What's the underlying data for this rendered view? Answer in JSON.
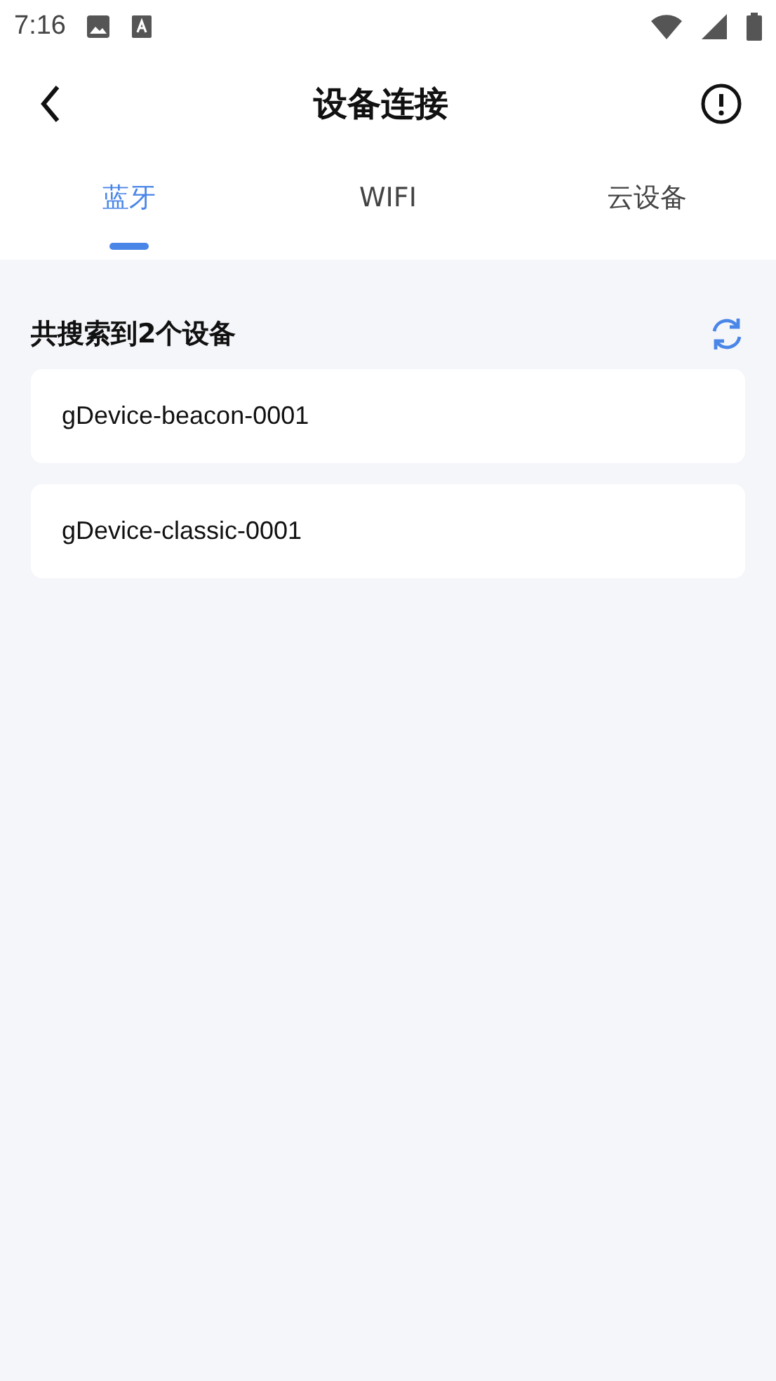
{
  "status_bar": {
    "time": "7:16"
  },
  "header": {
    "title": "设备连接"
  },
  "tabs": [
    {
      "label": "蓝牙",
      "selected": true
    },
    {
      "label": "WIFI",
      "selected": false
    },
    {
      "label": "云设备",
      "selected": false
    }
  ],
  "results": {
    "heading": "共搜索到2个设备"
  },
  "devices": [
    {
      "name": "gDevice-beacon-0001"
    },
    {
      "name": "gDevice-classic-0001"
    }
  ]
}
